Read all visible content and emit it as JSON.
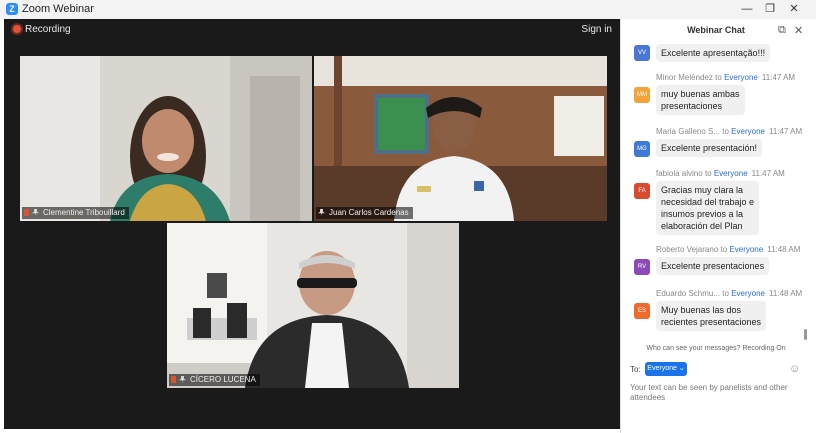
{
  "window": {
    "title": "Zoom Webinar",
    "minimize": "—",
    "maximize": "❐",
    "close": "✕",
    "logo": "Z"
  },
  "stage": {
    "recording": "Recording",
    "sign_in": "Sign in"
  },
  "participants": [
    {
      "name": "Clementine Tribouillard"
    },
    {
      "name": "Juan Carlos Cardenas"
    },
    {
      "name": "CÍCERO LUCENA"
    }
  ],
  "chat": {
    "title": "Webinar Chat",
    "popout_icon": "⧉",
    "close_icon": "✕",
    "messages": [
      {
        "initials": "VV",
        "color": "#4a77d4",
        "sender": "",
        "to": "",
        "recipient": "",
        "time": "",
        "text": "Excelente apresentação!!!"
      },
      {
        "initials": "MM",
        "color": "#f0a43a",
        "sender": "Minor Meléndez",
        "to": "to",
        "recipient": "Everyone",
        "time": "11:47 AM",
        "text": "muy buenas ambas\npresentaciones"
      },
      {
        "initials": "MG",
        "color": "#3f7bd6",
        "sender": "Maria Galleno S...",
        "to": "to",
        "recipient": "Everyone",
        "time": "11:47 AM",
        "text": "Excelente presentación!"
      },
      {
        "initials": "FA",
        "color": "#d84b2f",
        "sender": "fabiola alvino",
        "to": "to",
        "recipient": "Everyone",
        "time": "11:47 AM",
        "text": "Gracias muy clara la\nnecesidad del trabajo e\ninsumos previos a la\nelaboración del Plan"
      },
      {
        "initials": "RV",
        "color": "#8b4ab8",
        "sender": "Roberto Vejarano",
        "to": "to",
        "recipient": "Everyone",
        "time": "11:48 AM",
        "text": "Excelente presentaciones"
      },
      {
        "initials": "ES",
        "color": "#ef6a2c",
        "sender": "Eduardo Schmu...",
        "to": "to",
        "recipient": "Everyone",
        "time": "11:48 AM",
        "text": "Muy buenas las dos\nrecientes presentaciones"
      }
    ],
    "notice": "Who can see your messages? Recording On",
    "to_label": "To:",
    "recipient_button": "Everyone ⌄",
    "emoji_icon": "☺",
    "input_placeholder": "Your text can be seen by panelists and other attendees"
  }
}
